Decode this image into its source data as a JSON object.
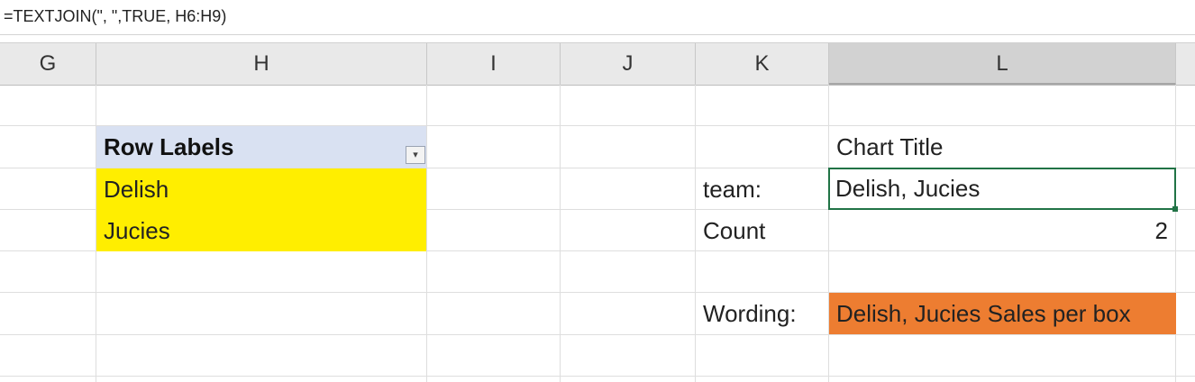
{
  "formula_bar": {
    "formula": "=TEXTJOIN(\", \",TRUE, H6:H9)"
  },
  "columns": [
    {
      "label": "G"
    },
    {
      "label": "H"
    },
    {
      "label": "I"
    },
    {
      "label": "J"
    },
    {
      "label": "K"
    },
    {
      "label": "L"
    }
  ],
  "pivot": {
    "header": "Row Labels",
    "items": [
      "Delish",
      "Jucies"
    ]
  },
  "summary": {
    "chart_title": "Chart Title",
    "team_label": "team:",
    "team_value": "Delish, Jucies",
    "count_label": "Count",
    "count_value": "2",
    "wording_label": "Wording:",
    "wording_value": "Delish, Jucies Sales per box"
  },
  "colors": {
    "pivot_header": "#d9e1f2",
    "highlight_yellow": "#ffee00",
    "highlight_orange": "#ed7d31",
    "selection_border": "#217346"
  },
  "icons": {
    "filter": "filter-dropdown-icon"
  }
}
